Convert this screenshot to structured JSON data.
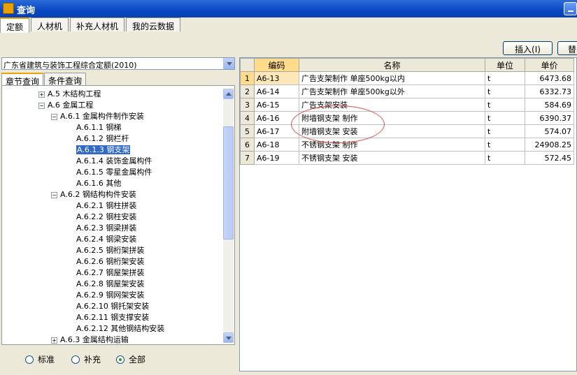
{
  "window": {
    "title": "查询"
  },
  "top_tabs": [
    "定额",
    "人材机",
    "补充人材机",
    "我的云数据"
  ],
  "toolbar": {
    "insert_label": "插入(I)",
    "replace_label": "替"
  },
  "combo": {
    "value": "广东省建筑与装饰工程综合定额(2010)"
  },
  "sub_tabs": [
    "章节查询",
    "条件查询"
  ],
  "tree": [
    {
      "label": "A.5 木结构工程",
      "level": 1,
      "expander": "+"
    },
    {
      "label": "A.6 金属工程",
      "level": 1,
      "expander": "−"
    },
    {
      "label": "A.6.1 金属构件制作安装",
      "level": 2,
      "expander": "−"
    },
    {
      "label": "A.6.1.1 钢梯",
      "level": 3
    },
    {
      "label": "A.6.1.2 钢栏杆",
      "level": 3
    },
    {
      "label": "A.6.1.3 钢支架",
      "level": 3,
      "selected": true
    },
    {
      "label": "A.6.1.4 装饰金属构件",
      "level": 3
    },
    {
      "label": "A.6.1.5 零星金属构件",
      "level": 3
    },
    {
      "label": "A.6.1.6 其他",
      "level": 3
    },
    {
      "label": "A.6.2 钢结构构件安装",
      "level": 2,
      "expander": "−"
    },
    {
      "label": "A.6.2.1 钢柱拼装",
      "level": 3
    },
    {
      "label": "A.6.2.2 钢柱安装",
      "level": 3
    },
    {
      "label": "A.6.2.3 钢梁拼装",
      "level": 3
    },
    {
      "label": "A.6.2.4 钢梁安装",
      "level": 3
    },
    {
      "label": "A.6.2.5 钢桁架拼装",
      "level": 3
    },
    {
      "label": "A.6.2.6 钢桁架安装",
      "level": 3
    },
    {
      "label": "A.6.2.7 钢屋架拼装",
      "level": 3
    },
    {
      "label": "A.6.2.8 钢屋架安装",
      "level": 3
    },
    {
      "label": "A.6.2.9 钢网架安装",
      "level": 3
    },
    {
      "label": "A.6.2.10 钢托架安装",
      "level": 3
    },
    {
      "label": "A.6.2.11 钢支撑安装",
      "level": 3
    },
    {
      "label": "A.6.2.12 其他钢结构安装",
      "level": 3
    },
    {
      "label": "A.6.3 金属结构运输",
      "level": 2,
      "expander": "+"
    }
  ],
  "radios": [
    {
      "label": "标准",
      "checked": false
    },
    {
      "label": "补充",
      "checked": false
    },
    {
      "label": "全部",
      "checked": true
    }
  ],
  "grid": {
    "headers": [
      "",
      "编码",
      "名称",
      "单位",
      "单价"
    ],
    "rows": [
      [
        "1",
        "A6-13",
        "广告支架制作 单座500kg以内",
        "t",
        "6473.68"
      ],
      [
        "2",
        "A6-14",
        "广告支架制作 单座500kg以外",
        "t",
        "6332.73"
      ],
      [
        "3",
        "A6-15",
        "广告支架安装",
        "t",
        "584.69"
      ],
      [
        "4",
        "A6-16",
        "附墙钢支架 制作",
        "t",
        "6390.37"
      ],
      [
        "5",
        "A6-17",
        "附墙钢支架 安装",
        "t",
        "574.07"
      ],
      [
        "6",
        "A6-18",
        "不锈钢支架 制作",
        "t",
        "24908.25"
      ],
      [
        "7",
        "A6-19",
        "不锈钢支架 安装",
        "t",
        "572.45"
      ]
    ],
    "current_row": 0
  },
  "colors": {
    "titlebar": "#0a48c4",
    "selection": "#316ac5",
    "highlight": "#ffdc8c",
    "annotation": "#d9534f"
  }
}
